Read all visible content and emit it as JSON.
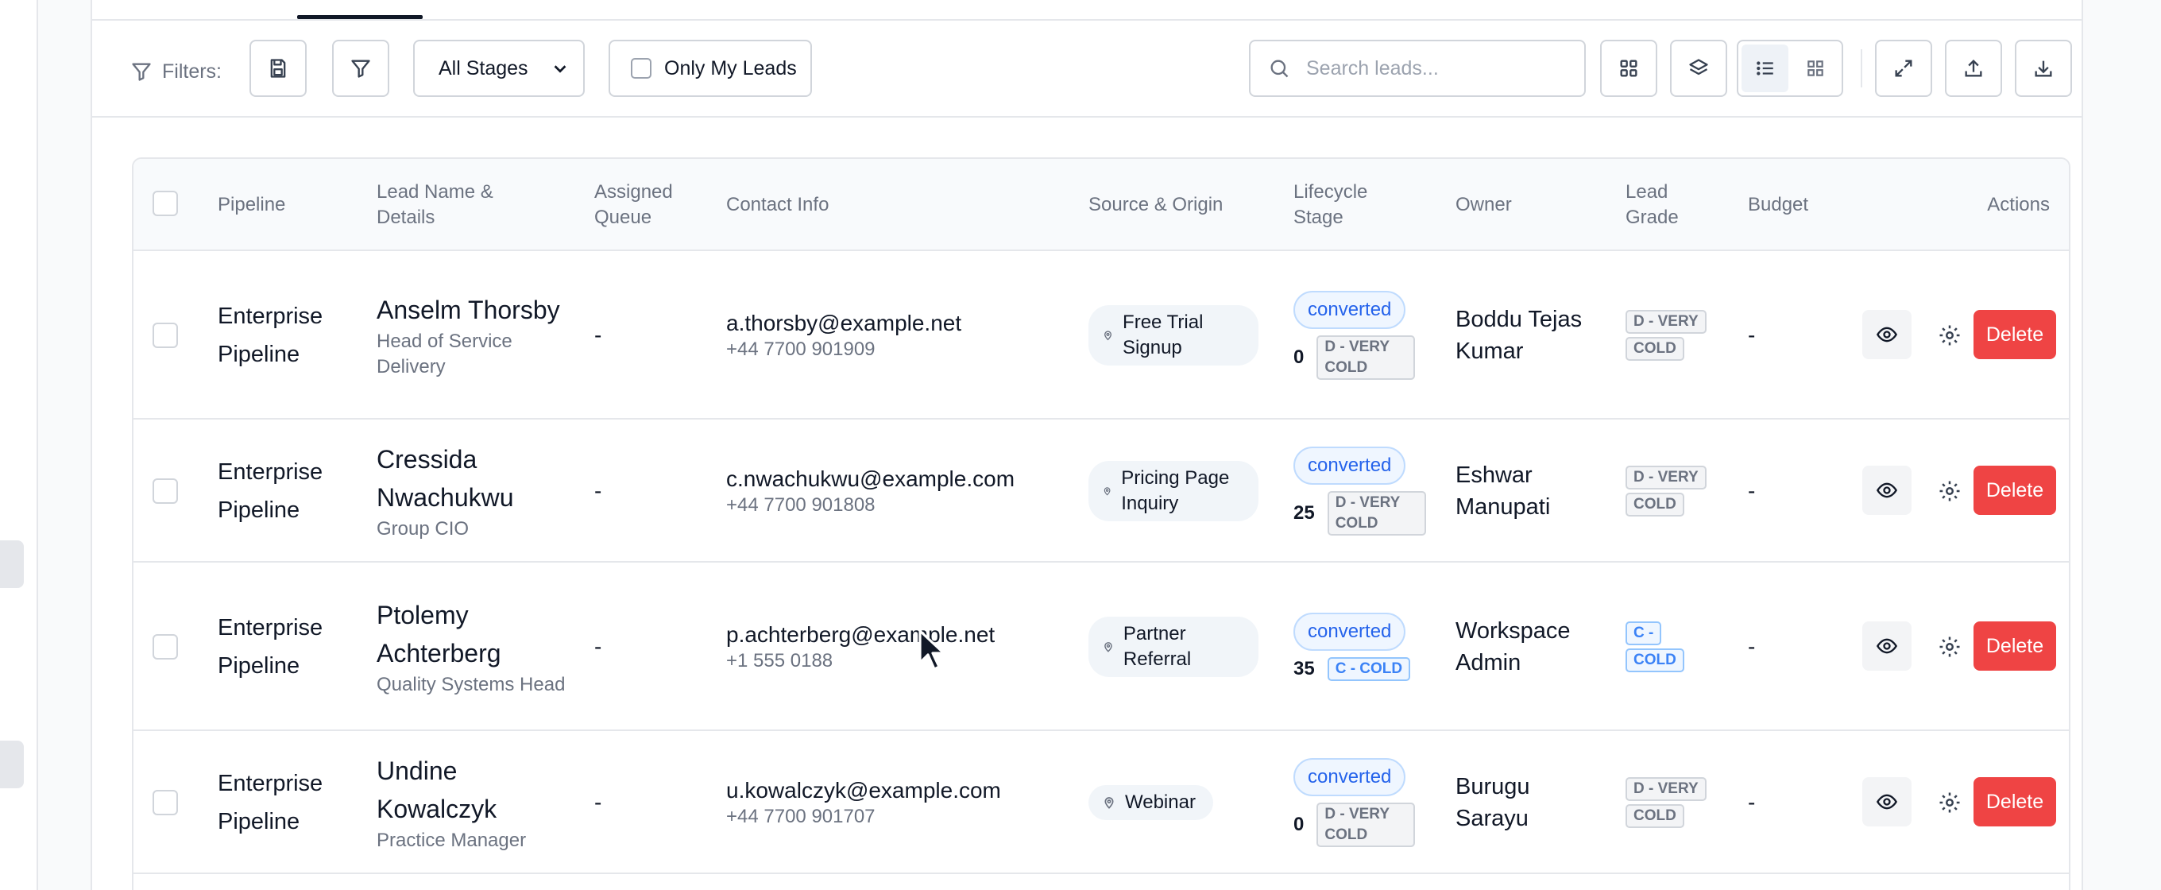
{
  "toolbar": {
    "filters_label": "Filters:",
    "stage_select": "All Stages",
    "only_my_leads": "Only My Leads",
    "search_placeholder": "Search leads..."
  },
  "table": {
    "columns": {
      "pipeline": "Pipeline",
      "lead_name": "Lead Name & Details",
      "assigned_queue": "Assigned Queue",
      "contact_info": "Contact Info",
      "source_origin": "Source & Origin",
      "lifecycle_stage": "Lifecycle Stage",
      "owner": "Owner",
      "lead_grade": "Lead Grade",
      "budget": "Budget",
      "actions": "Actions"
    },
    "delete_label": "Delete",
    "rows": [
      {
        "pipeline": "Enterprise Pipeline",
        "name": "Anselm Thorsby",
        "title": "Head of Service Delivery",
        "queue": "-",
        "email": "a.thorsby@example.net",
        "phone": "+44 7700 901909",
        "source": "Free Trial Signup",
        "stage": "converted",
        "score": "0",
        "score_grade": "D - VERY COLD",
        "owner": "Boddu Tejas Kumar",
        "grade_top": "D - VERY",
        "grade_bottom": "COLD",
        "budget": "-"
      },
      {
        "pipeline": "Enterprise Pipeline",
        "name": "Cressida Nwachukwu",
        "title": "Group CIO",
        "queue": "-",
        "email": "c.nwachukwu@example.com",
        "phone": "+44 7700 901808",
        "source": "Pricing Page Inquiry",
        "stage": "converted",
        "score": "25",
        "score_grade": "D - VERY COLD",
        "owner": "Eshwar Manupati",
        "grade_top": "D - VERY",
        "grade_bottom": "COLD",
        "budget": "-"
      },
      {
        "pipeline": "Enterprise Pipeline",
        "name": "Ptolemy Achterberg",
        "title": "Quality Systems Head",
        "queue": "-",
        "email": "p.achterberg@example.net",
        "phone": "+1 555 0188",
        "source": "Partner Referral",
        "stage": "converted",
        "score": "35",
        "score_grade": "C - COLD",
        "owner": "Workspace Admin",
        "grade_top": "C -",
        "grade_bottom": "COLD",
        "budget": "-"
      },
      {
        "pipeline": "Enterprise Pipeline",
        "name": "Undine Kowalczyk",
        "title": "Practice Manager",
        "queue": "-",
        "email": "u.kowalczyk@example.com",
        "phone": "+44 7700 901707",
        "source": "Webinar",
        "stage": "converted",
        "score": "0",
        "score_grade": "D - VERY COLD",
        "owner": "Burugu Sarayu",
        "grade_top": "D - VERY",
        "grade_bottom": "COLD",
        "budget": "-"
      }
    ]
  },
  "colors": {
    "accent": "#2563eb",
    "danger": "#ef4444",
    "border": "#e5e7eb"
  }
}
